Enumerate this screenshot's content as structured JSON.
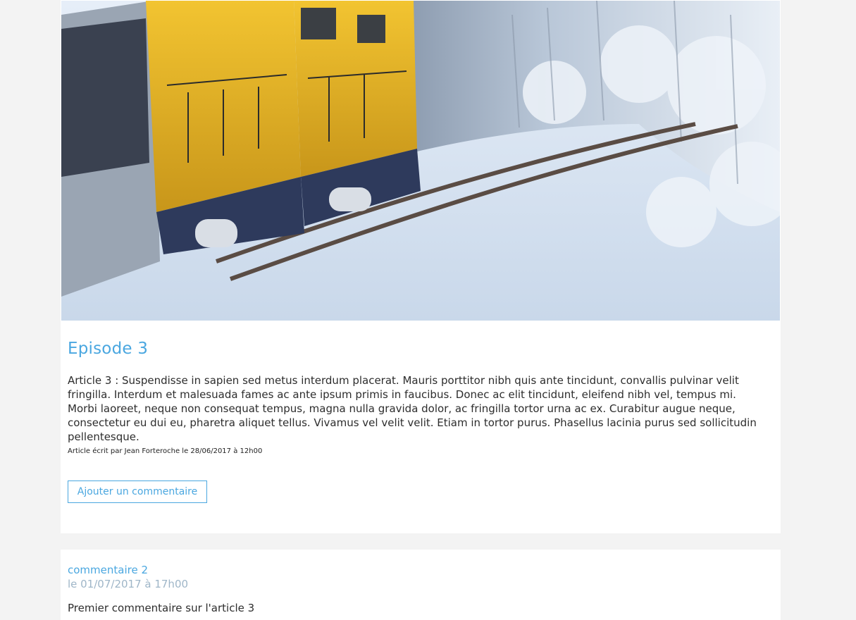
{
  "article": {
    "image_alt": "Train jaune et bleu dans un paysage enneigé",
    "title": "Episode 3",
    "body": "Article 3 : Suspendisse in sapien sed metus interdum placerat. Mauris porttitor nibh quis ante tincidunt, convallis pulvinar velit fringilla. Interdum et malesuada fames ac ante ipsum primis in faucibus. Donec ac elit tincidunt, eleifend nibh vel, tempus mi. Morbi laoreet, neque non consequat tempus, magna nulla gravida dolor, ac fringilla tortor urna ac ex. Curabitur augue neque, consectetur eu dui eu, pharetra aliquet tellus. Vivamus vel velit velit. Etiam in tortor purus. Phasellus lacinia purus sed sollicitudin pellentesque.",
    "meta": "Article écrit par Jean Forteroche le 28/06/2017 à 12h00",
    "add_comment_label": "Ajouter un commentaire"
  },
  "comment": {
    "author": "commentaire 2",
    "date": "le 01/07/2017 à 17h00",
    "text": "Premier commentaire sur l'article 3"
  },
  "colors": {
    "accent": "#4aa7e0",
    "page_background": "#f3f3f3",
    "card_background": "#ffffff",
    "date_text": "#9fb6c8"
  }
}
